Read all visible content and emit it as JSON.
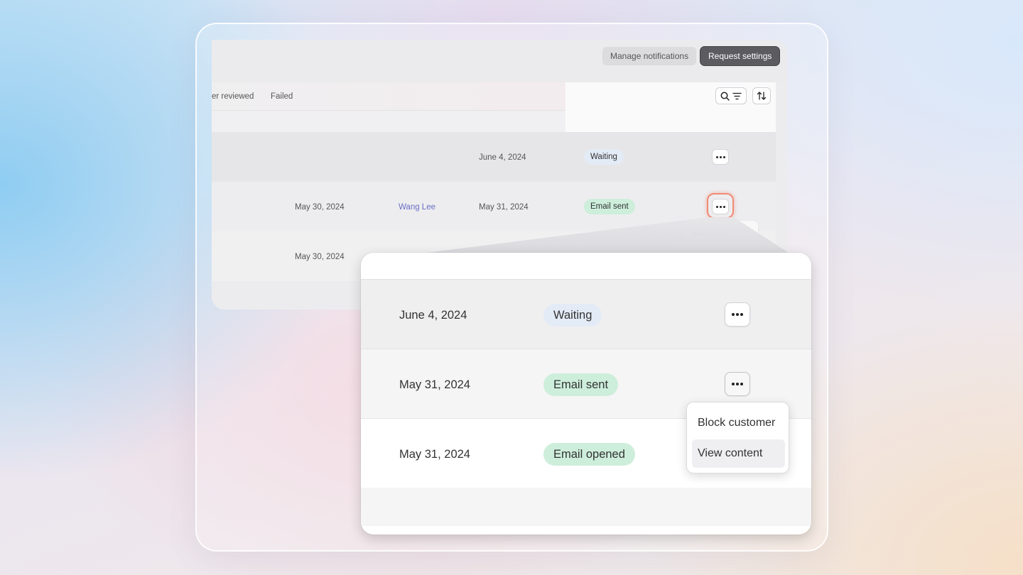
{
  "toolbar": {
    "manage_notifications": "Manage notifications",
    "request_settings": "Request settings"
  },
  "tabs": [
    "er reviewed",
    "Failed"
  ],
  "icons": {
    "search_filter": "search-filter-icon",
    "sort": "sort-icon",
    "more": "more-horizontal-icon"
  },
  "background_table": {
    "rows": [
      {
        "request_date": "",
        "reviewer": "",
        "sent_date": "June 4, 2024",
        "status": "Waiting",
        "status_kind": "waiting"
      },
      {
        "request_date": "May 30, 2024",
        "reviewer": "Wang Lee",
        "sent_date": "May 31, 2024",
        "status": "Email sent",
        "status_kind": "sent"
      },
      {
        "request_date": "May 30, 2024",
        "reviewer": "",
        "sent_date": "",
        "status": "",
        "status_kind": ""
      }
    ],
    "ghost_menu_item": "Block cu"
  },
  "zoom_table": {
    "rows": [
      {
        "date": "June 4, 2024",
        "status": "Waiting",
        "status_kind": "waiting"
      },
      {
        "date": "May 31, 2024",
        "status": "Email sent",
        "status_kind": "sent"
      },
      {
        "date": "May 31, 2024",
        "status": "Email opened",
        "status_kind": "sent"
      }
    ]
  },
  "dropdown_menu": {
    "items": [
      "Block customer",
      "View content"
    ],
    "hovered_index": 1
  },
  "colors": {
    "waiting_chip": "#e3ebf6",
    "sent_chip": "#cdeedb",
    "highlight_ring": "#f08a76",
    "link": "#6a6fc6"
  }
}
